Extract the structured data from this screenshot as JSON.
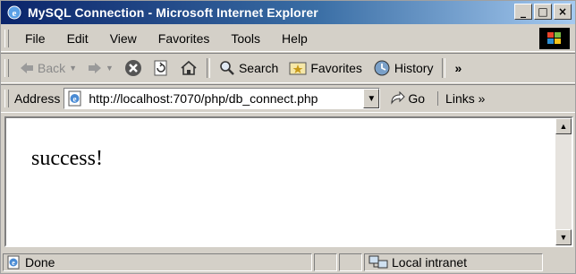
{
  "window": {
    "title": "MySQL Connection - Microsoft Internet Explorer",
    "btn_min": "_",
    "btn_max": "□",
    "btn_close": "×"
  },
  "menu": {
    "items": [
      "File",
      "Edit",
      "View",
      "Favorites",
      "Tools",
      "Help"
    ]
  },
  "toolbar": {
    "back": "Back",
    "search": "Search",
    "favorites": "Favorites",
    "history": "History",
    "more": "»"
  },
  "address": {
    "label": "Address",
    "url": "http://localhost:7070/php/db_connect.php",
    "go": "Go",
    "links": "Links »"
  },
  "page": {
    "text": "success!"
  },
  "status": {
    "left": "Done",
    "zone": "Local intranet"
  }
}
